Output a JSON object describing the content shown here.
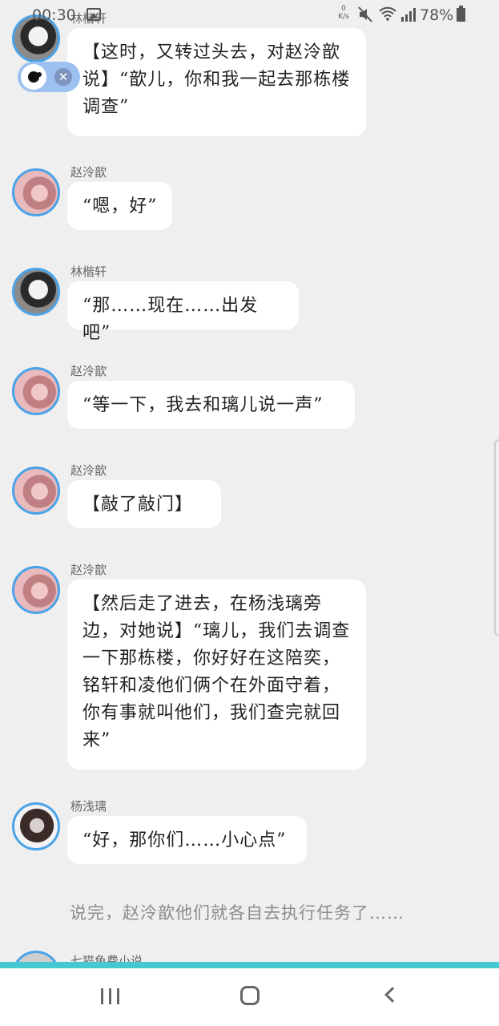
{
  "status_bar": {
    "time": "00:30",
    "net_speed_value": "0",
    "net_speed_unit": "K/s",
    "battery": "78%",
    "icons": [
      "image-icon",
      "mute-icon",
      "wifi-icon",
      "signal-icon",
      "battery-icon"
    ]
  },
  "mini_player": {
    "close_symbol": "✕"
  },
  "messages": [
    {
      "sender": "林楷轩",
      "text": "【这时，又转过头去，对赵泠歆说】“歆儿，你和我一起去那栋楼调查”"
    },
    {
      "sender": "赵泠歆",
      "text": "“嗯，好”"
    },
    {
      "sender": "林楷轩",
      "text": "“那……现在……出发吧”"
    },
    {
      "sender": "赵泠歆",
      "text": "“等一下，我去和璃儿说一声”"
    },
    {
      "sender": "赵泠歆",
      "text": "【敲了敲门】"
    },
    {
      "sender": "赵泠歆",
      "text": "【然后走了进去，在杨浅璃旁边，对她说】“璃儿，我们去调查一下那栋楼，你好好在这陪奕，铭轩和凌他们俩个在外面守着，你有事就叫他们，我们查完就回来”"
    },
    {
      "sender": "杨浅璃",
      "text": "“好，那你们……小心点”"
    }
  ],
  "narration": "说完，赵泠歆他们就各自去执行任务了……",
  "peek_sender": "七猫鱼费小说",
  "colors": {
    "accent_line": "#44c9d2",
    "avatar_ring": "#4aa3e8",
    "background": "#efefef"
  }
}
